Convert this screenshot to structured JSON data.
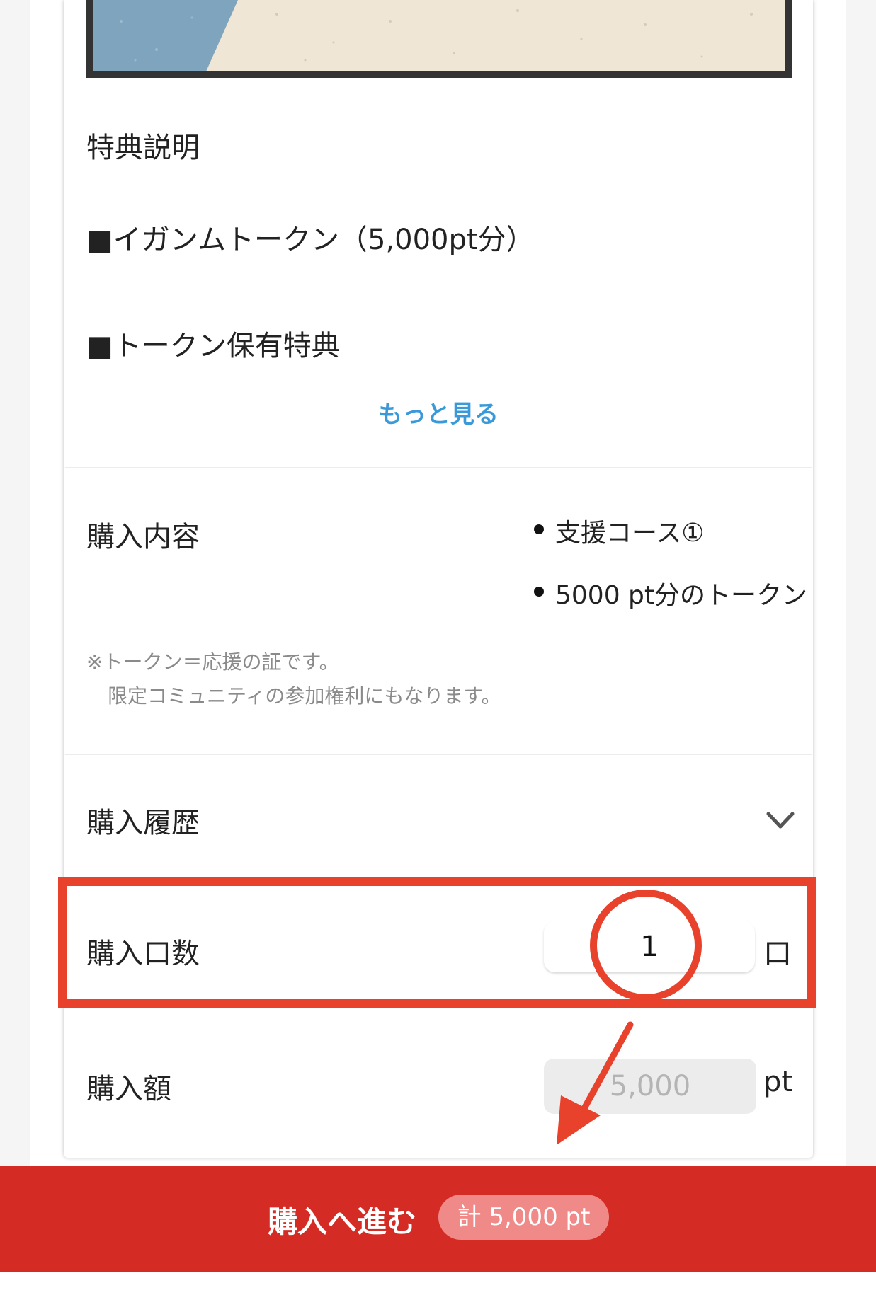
{
  "perk": {
    "section_title": "特典説明",
    "item_token": "■イガンムトークン（5,000pt分）",
    "item_benefit": "■トークン保有特典",
    "more_link": "もっと見る"
  },
  "contents": {
    "section_title": "購入内容",
    "bullets": [
      "支援コース①",
      "5000 pt分のトークン"
    ],
    "note_line1": "※トークン＝応援の証です。",
    "note_line2": "限定コミュニティの参加権利にもなります。"
  },
  "history": {
    "section_title": "購入履歴",
    "icon": "chevron-down-icon"
  },
  "quantity": {
    "label": "購入口数",
    "value": "1",
    "unit": "口"
  },
  "amount": {
    "label": "購入額",
    "value": "5,000",
    "unit": "pt"
  },
  "purchase": {
    "button_label": "購入へ進む",
    "total": "計 5,000 pt"
  },
  "colors": {
    "accent": "#d42b24",
    "link": "#3a9ad9",
    "annotation": "#e8412c"
  }
}
